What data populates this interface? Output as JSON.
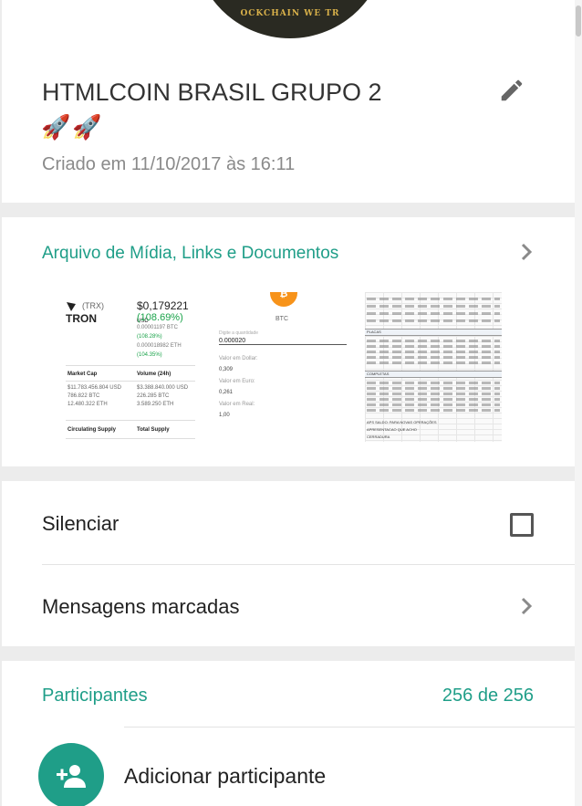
{
  "header": {
    "coin_text": "OCKCHAIN WE TR",
    "group_name": "HTMLCOIN BRASIL GRUPO 2",
    "emoji": "🚀🚀",
    "created": "Criado em 11/10/2017 às 16:11",
    "edit_icon": "pencil-icon"
  },
  "media": {
    "label": "Arquivo de Mídia, Links e Documentos",
    "thumb1": {
      "ticker": "(TRX)",
      "name": "TRON",
      "price": "$0,179221",
      "price_unit": "USD",
      "change": "(108.69%)",
      "btc": "0.00001197 BTC",
      "btc_change": "(108.28%)",
      "eth": "0.000018982 ETH",
      "eth_change": "(104.35%)",
      "market_cap_label": "Market Cap",
      "volume_label": "Volume (24h)",
      "market_cap_values": [
        "$11.783.456.804 USD",
        "786.822 BTC",
        "12.480.322 ETH"
      ],
      "volume_values": [
        "$3.388.840.000 USD",
        "226.285 BTC",
        "3.589.250 ETH"
      ],
      "circulating_label": "Circulating Supply",
      "total_label": "Total Supply"
    },
    "thumb2": {
      "coin_symbol": "₿",
      "coin_name": "BTC",
      "placeholder": "Digite a quantidade",
      "amount": "0.000020",
      "dollar_label": "Valor em Dollar:",
      "dollar_value": "0,309",
      "euro_label": "Valor em Euro:",
      "euro_value": "0,261",
      "real_label": "Valor em Real:",
      "real_value": "1,00"
    },
    "thumb3": {
      "section1": "PLACAS",
      "section2": "COMPLETAS",
      "footer": [
        "APS SALDO: PARA NOVAS OPERAÇÕES",
        "APRESENTACAO QUE ACHO",
        "CERRADURA"
      ]
    }
  },
  "settings": {
    "mute_label": "Silenciar",
    "mute_checked": false,
    "starred_label": "Mensagens marcadas"
  },
  "participants": {
    "title": "Participantes",
    "count": "256 de 256",
    "add_label": "Adicionar participante"
  },
  "colors": {
    "accent": "#1f9e88",
    "background": "#ececec",
    "card": "#ffffff"
  }
}
